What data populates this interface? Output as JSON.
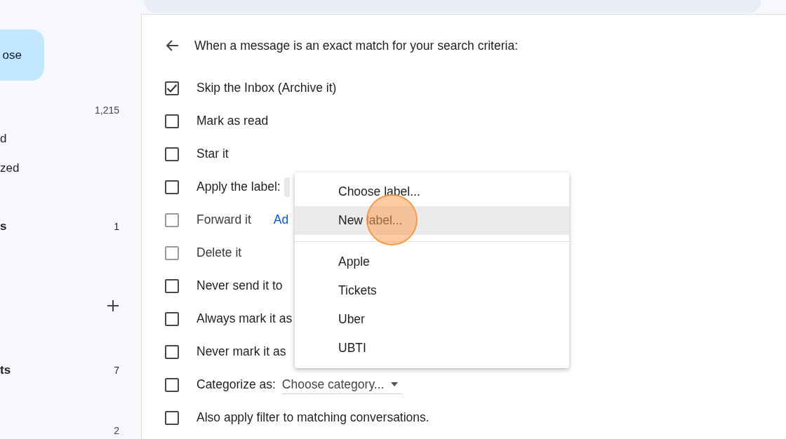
{
  "sidebar": {
    "compose_button": "ose",
    "items": [
      {
        "kind": "folder",
        "count": "1,215",
        "bold": false
      },
      {
        "kind": "folder",
        "label": "d",
        "bold": false
      },
      {
        "kind": "folder",
        "label": "zed",
        "bold": false
      },
      {
        "kind": "folder",
        "label": "s",
        "count": "1",
        "bold": true
      },
      {
        "kind": "add"
      },
      {
        "kind": "folder",
        "label": "ts",
        "count": "7",
        "bold": true
      },
      {
        "kind": "folder",
        "count": "2",
        "bold": false
      }
    ]
  },
  "filter": {
    "heading": "When a message is an exact match for your search criteria:",
    "actions": [
      {
        "label": "Skip the Inbox (Archive it)",
        "checked": true,
        "disabled": false
      },
      {
        "label": "Mark as read",
        "checked": false,
        "disabled": false
      },
      {
        "label": "Star it",
        "checked": false,
        "disabled": false
      },
      {
        "label": "Apply the label:",
        "checked": false,
        "disabled": false,
        "kind": "label_select"
      },
      {
        "label": "Forward it",
        "checked": false,
        "disabled": true,
        "kind": "link",
        "link": "Ad"
      },
      {
        "label": "Delete it",
        "checked": false,
        "disabled": true
      },
      {
        "label": "Never send it to",
        "checked": false,
        "disabled": false
      },
      {
        "label": "Always mark it as",
        "checked": false,
        "disabled": false
      },
      {
        "label": "Never mark it as",
        "checked": false,
        "disabled": false
      },
      {
        "label": "Categorize as:",
        "checked": false,
        "disabled": false,
        "kind": "category_select",
        "value": "Choose category..."
      },
      {
        "label": "Also apply filter to matching conversations.",
        "checked": false,
        "disabled": false
      }
    ]
  },
  "label_menu": {
    "actions": [
      {
        "label": "Choose label...",
        "selected": false
      },
      {
        "label": "New label...",
        "selected": true
      }
    ],
    "labels": [
      {
        "label": "Apple",
        "selected": false
      },
      {
        "label": "Tickets",
        "selected": false
      },
      {
        "label": "Uber",
        "selected": false
      },
      {
        "label": "UBTI",
        "selected": false
      }
    ]
  }
}
